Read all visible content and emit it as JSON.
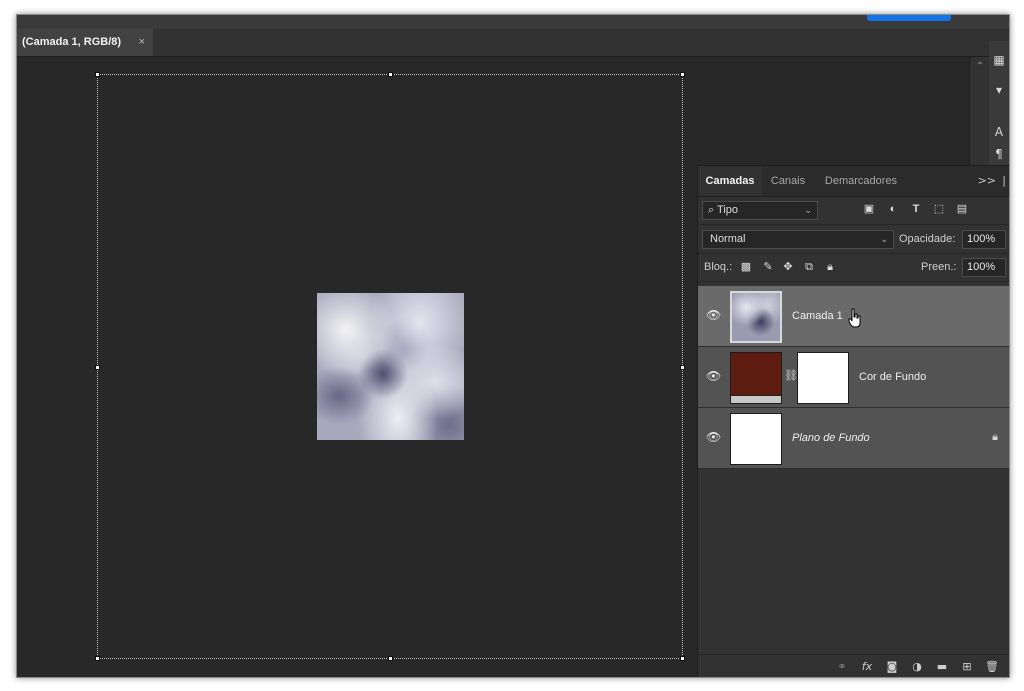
{
  "document_tab": {
    "title": "(Camada 1, RGB/8)",
    "close": "×"
  },
  "layers_panel": {
    "tabs": [
      {
        "label": "Camadas"
      },
      {
        "label": "Canais"
      },
      {
        "label": "Demarcadores"
      }
    ],
    "more": ">>",
    "filter": {
      "icon": "search-icon",
      "label": "Tipo"
    },
    "blend_mode": "Normal",
    "opacity": {
      "label": "Opacidade:",
      "value": "100%"
    },
    "lock": {
      "label": "Bloq.:"
    },
    "fill": {
      "label": "Preen.:",
      "value": "100%"
    },
    "layers": [
      {
        "name": "Camada 1",
        "visible": true,
        "selected": true
      },
      {
        "name": "Cor de Fundo",
        "visible": true,
        "thumb_color": "#5e1c11",
        "mask_color": "#ffffff"
      },
      {
        "name": "Plano de Fundo",
        "visible": true,
        "locked": true,
        "thumb_color": "#ffffff"
      }
    ]
  },
  "colors": {
    "accent": "#1473e6",
    "canvas_bg": "#282828",
    "panel_bg": "#323232",
    "layer_selected": "#6a6a6a",
    "fill_layer": "#5e1c11"
  }
}
